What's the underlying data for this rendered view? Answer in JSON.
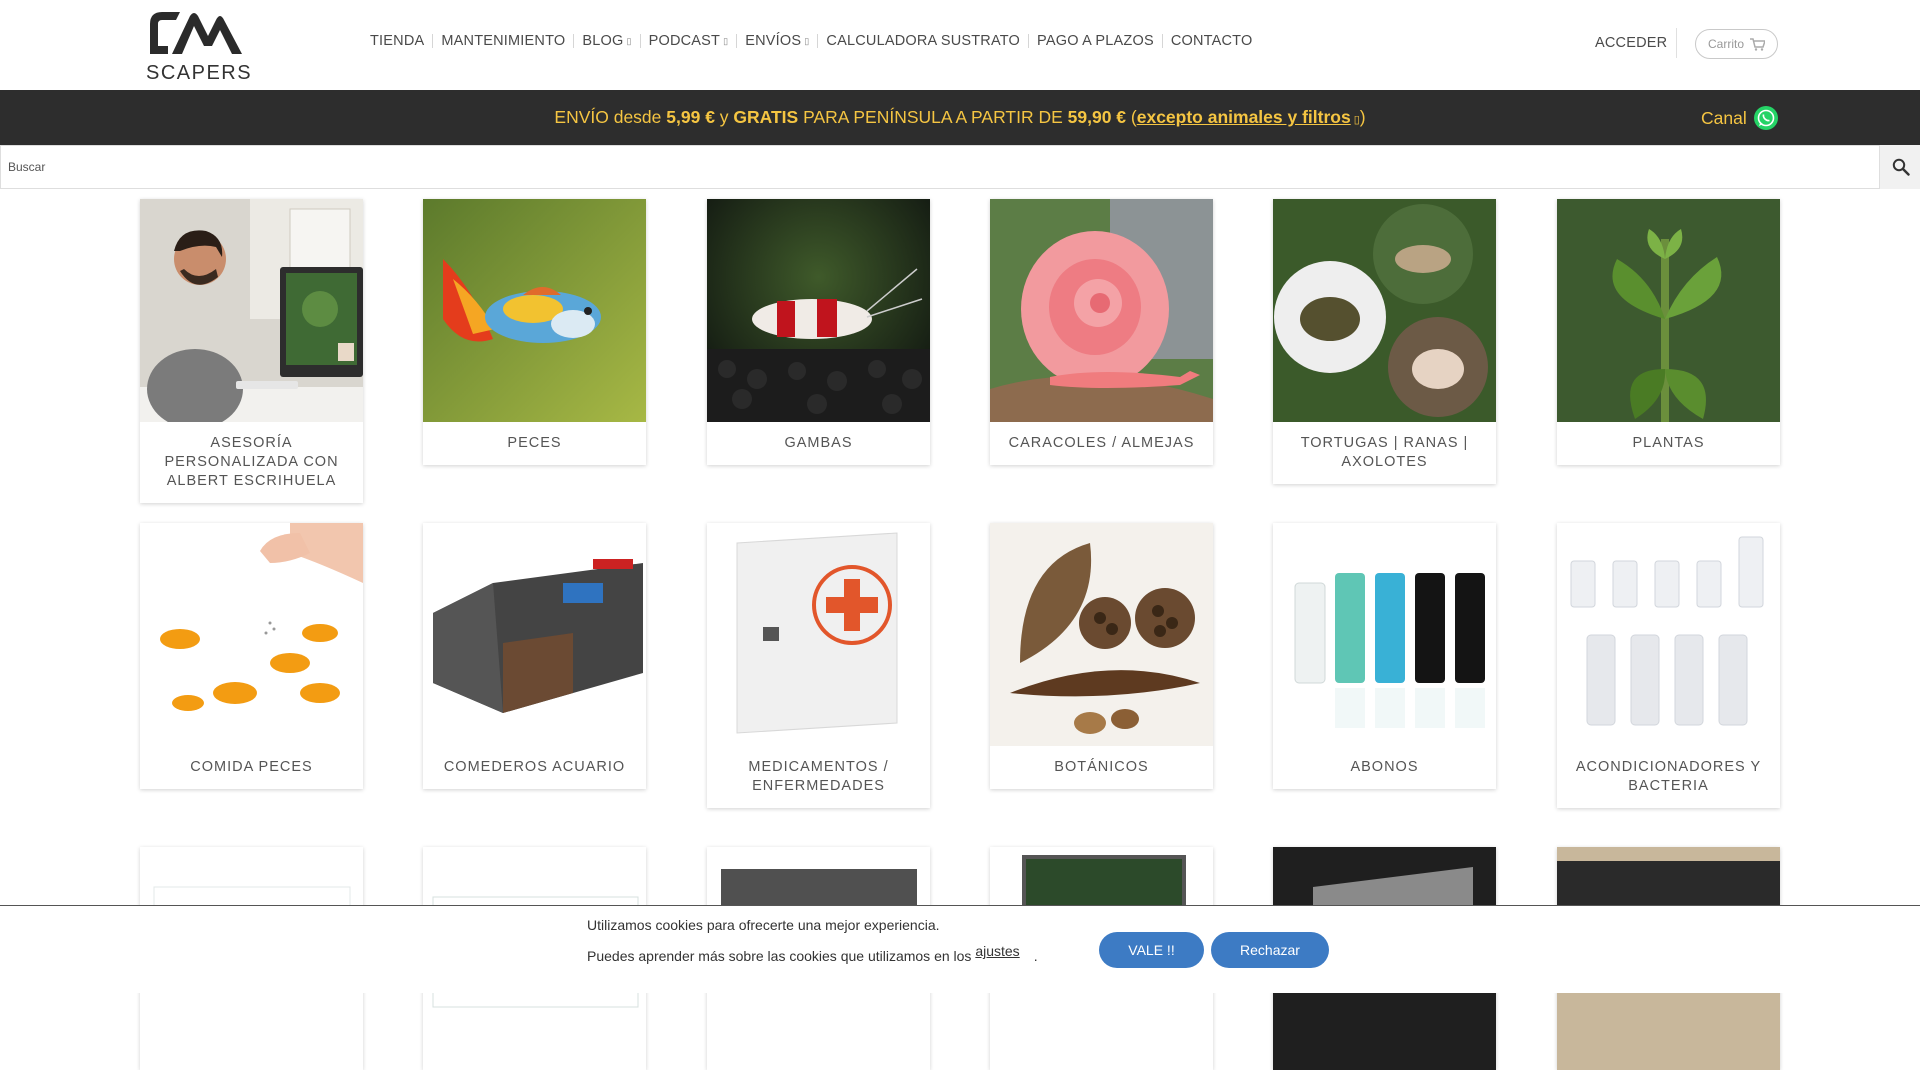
{
  "header": {
    "logo_text": "SCAPERS",
    "nav": [
      {
        "label": "TIENDA",
        "dropdown": false
      },
      {
        "label": "MANTENIMIENTO",
        "dropdown": false
      },
      {
        "label": "BLOG",
        "dropdown": true
      },
      {
        "label": "PODCAST",
        "dropdown": true
      },
      {
        "label": "ENVÍOS",
        "dropdown": true
      },
      {
        "label": "CALCULADORA SUSTRATO",
        "dropdown": false
      },
      {
        "label": "PAGO A PLAZOS",
        "dropdown": false
      },
      {
        "label": "CONTACTO",
        "dropdown": false
      }
    ],
    "login_label": "ACCEDER",
    "cart_label": "Carrito"
  },
  "banner": {
    "part1": "ENVÍO desde ",
    "price1": "5,99 €",
    "part2": " y ",
    "gratis": "GRATIS",
    "part3": " PARA PENÍNSULA A PARTIR DE ",
    "price2": "59,90 €",
    "part4": " (",
    "link": "excepto animales y filtros",
    "part5": ")",
    "canal_label": "Canal",
    "accent_color": "#f5c542"
  },
  "search": {
    "placeholder": "Buscar"
  },
  "categories": [
    {
      "label": "ASESORÍA PERSONALIZADA CON ALBERT ESCRIHUELA"
    },
    {
      "label": "PECES"
    },
    {
      "label": "GAMBAS"
    },
    {
      "label": "CARACOLES / ALMEJAS"
    },
    {
      "label": "TORTUGAS | RANAS | AXOLOTES"
    },
    {
      "label": "PLANTAS"
    },
    {
      "label": "COMIDA PECES"
    },
    {
      "label": "COMEDEROS ACUARIO"
    },
    {
      "label": "MEDICAMENTOS / ENFERMEDADES"
    },
    {
      "label": "BOTÁNICOS"
    },
    {
      "label": "ABONOS"
    },
    {
      "label": "ACONDICIONADORES Y BACTERIA"
    }
  ],
  "cookie": {
    "line1": "Utilizamos cookies para ofrecerte una mejor experiencia.",
    "line2": "Puedes aprender más sobre las cookies que utilizamos en los ",
    "link": "ajustes",
    "line2_end": ".",
    "accept_label": "VALE !!",
    "reject_label": "Rechazar",
    "button_color": "#3d7bc4"
  }
}
